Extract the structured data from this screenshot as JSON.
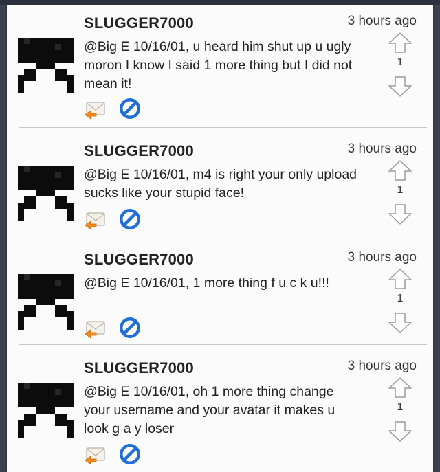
{
  "colors": {
    "background": "#fbfbfb",
    "divider": "#c7c7c7",
    "block_blue": "#1f6fd6",
    "reply_orange": "#f08a1c",
    "avatar_black": "#0c0c0c"
  },
  "comments": [
    {
      "username": "SLUGGER7000",
      "time": "3 hours ago",
      "text": "@Big E 10/16/01, u heard him shut up u ugly moron I know I said 1 more thing but I did not mean it!",
      "votes": "1",
      "reply_icon": "reply-envelope-icon",
      "block_icon": "block-icon"
    },
    {
      "username": "SLUGGER7000",
      "time": "3 hours ago",
      "text": "@Big E 10/16/01, m4 is right your only upload sucks like your stupid face!",
      "votes": "1",
      "reply_icon": "reply-envelope-icon",
      "block_icon": "block-icon"
    },
    {
      "username": "SLUGGER7000",
      "time": "3 hours ago",
      "text": "@Big E 10/16/01, 1 more thing f u c k u!!!",
      "votes": "1",
      "reply_icon": "reply-envelope-icon",
      "block_icon": "block-icon"
    },
    {
      "username": "SLUGGER7000",
      "time": "3 hours ago",
      "text": "@Big E 10/16/01, oh 1 more thing change your username and your avatar it makes u look g a y loser",
      "votes": "1",
      "reply_icon": "reply-envelope-icon",
      "block_icon": "block-icon"
    }
  ]
}
